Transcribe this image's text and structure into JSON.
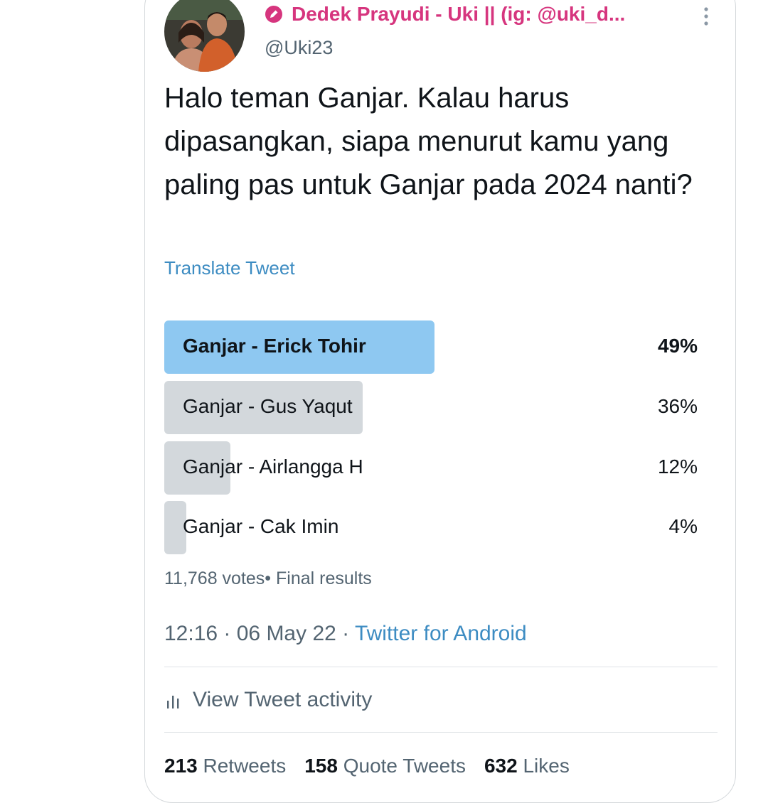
{
  "author": {
    "display_name": "Dedek Prayudi - Uki || (ig: @uki_d...",
    "handle": "@Uki23",
    "badge_icon": "pencil-icon",
    "name_color": "#d6357e"
  },
  "tweet": {
    "text": "Halo teman Ganjar. Kalau harus dipasangkan, siapa menurut kamu yang paling pas untuk Ganjar pada 2024 nanti?",
    "translate_label": "Translate Tweet"
  },
  "poll": {
    "options": [
      {
        "label": "Ganjar - Erick Tohir",
        "percent_text": "49%",
        "percent": 49,
        "winner": true
      },
      {
        "label": "Ganjar - Gus Yaqut",
        "percent_text": "36%",
        "percent": 36,
        "winner": false
      },
      {
        "label": "Ganjar - Airlangga H",
        "percent_text": "12%",
        "percent": 12,
        "winner": false
      },
      {
        "label": "Ganjar - Cak Imin",
        "percent_text": "4%",
        "percent": 4,
        "winner": false
      }
    ],
    "summary": "11,768 votes• Final results",
    "winner_color": "#8ec8f1",
    "bar_color": "#d3d8dc"
  },
  "meta": {
    "time_date": "12:16 · 06 May 22 · ",
    "source": "Twitter for Android"
  },
  "activity": {
    "label": "View Tweet activity",
    "icon": "bar-chart-icon"
  },
  "stats": {
    "retweets_count": "213",
    "retweets_label": "Retweets",
    "quotes_count": "158",
    "quotes_label": "Quote Tweets",
    "likes_count": "632",
    "likes_label": "Likes"
  }
}
